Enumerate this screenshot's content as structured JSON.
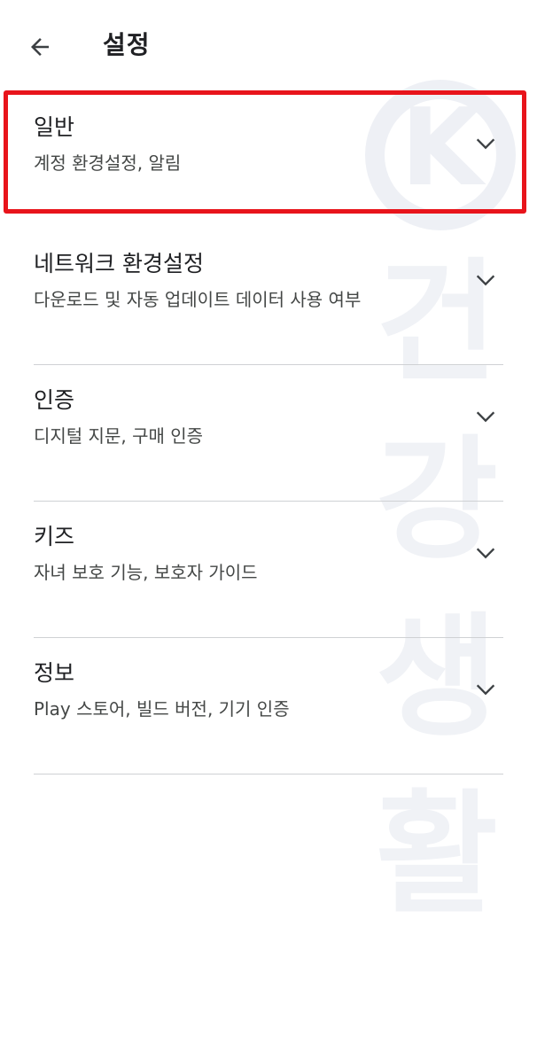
{
  "header": {
    "title": "설정",
    "back_icon": "arrow-left-icon"
  },
  "settings": [
    {
      "title": "일반",
      "subtitle": "계정 환경설정, 알림",
      "expand_icon": "chevron-down-icon",
      "highlighted": true
    },
    {
      "title": "네트워크 환경설정",
      "subtitle": "다운로드 및 자동 업데이트 데이터 사용 여부",
      "expand_icon": "chevron-down-icon"
    },
    {
      "title": "인증",
      "subtitle": "디지털 지문, 구매 인증",
      "expand_icon": "chevron-down-icon"
    },
    {
      "title": "키즈",
      "subtitle": "자녀 보호 기능, 보호자 가이드",
      "expand_icon": "chevron-down-icon"
    },
    {
      "title": "정보",
      "subtitle": "Play 스토어, 빌드 버전, 기기 인증",
      "expand_icon": "chevron-down-icon"
    }
  ],
  "watermark": {
    "letter": "K",
    "chars": [
      "건",
      "강",
      "생",
      "활"
    ]
  },
  "colors": {
    "highlight": "#e8141b",
    "text_primary": "#202124",
    "text_secondary": "#444746",
    "divider": "#cfd1d4",
    "watermark": "#eef0f5"
  }
}
